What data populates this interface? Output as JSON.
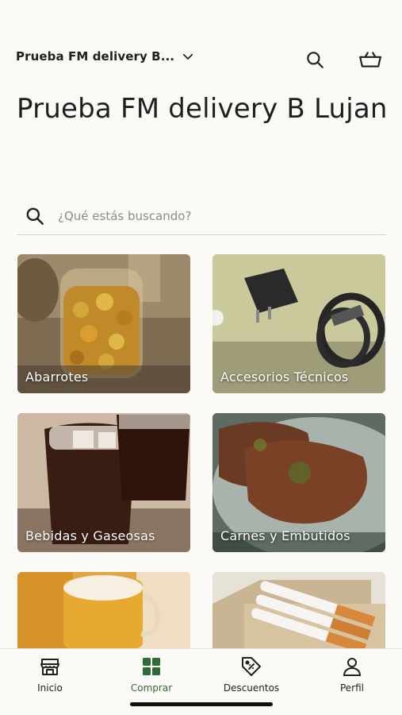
{
  "header": {
    "store_name": "Prueba FM delivery B...",
    "search_icon": "search-icon",
    "basket_icon": "basket-icon"
  },
  "page_title": "Prueba FM delivery B Lujan",
  "search": {
    "placeholder": "¿Qué estás buscando?"
  },
  "categories": [
    {
      "label": "Abarrotes"
    },
    {
      "label": "Accesorios Técnicos"
    },
    {
      "label": "Bebidas y Gaseosas"
    },
    {
      "label": "Carnes y Embutidos"
    },
    {
      "label": ""
    },
    {
      "label": ""
    }
  ],
  "nav": [
    {
      "label": "Inicio",
      "icon": "store-icon"
    },
    {
      "label": "Comprar",
      "icon": "grid-icon",
      "active": true
    },
    {
      "label": "Descuentos",
      "icon": "tag-icon"
    },
    {
      "label": "Perfil",
      "icon": "user-icon"
    }
  ],
  "colors": {
    "accent": "#2e6b3b",
    "background": "#fcfaf6"
  }
}
